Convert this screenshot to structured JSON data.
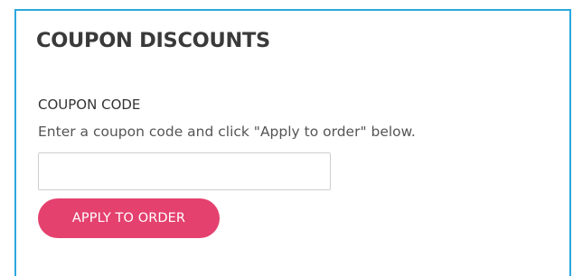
{
  "coupon_section": {
    "heading": "COUPON DISCOUNTS",
    "code_label": "COUPON CODE",
    "hint": "Enter a coupon code and click \"Apply to order\" below.",
    "input_value": "",
    "input_placeholder": "",
    "apply_button_label": "APPLY TO ORDER"
  },
  "colors": {
    "panel_border": "#2aa9e0",
    "button_background": "#e4416f",
    "button_text": "#ffffff"
  }
}
